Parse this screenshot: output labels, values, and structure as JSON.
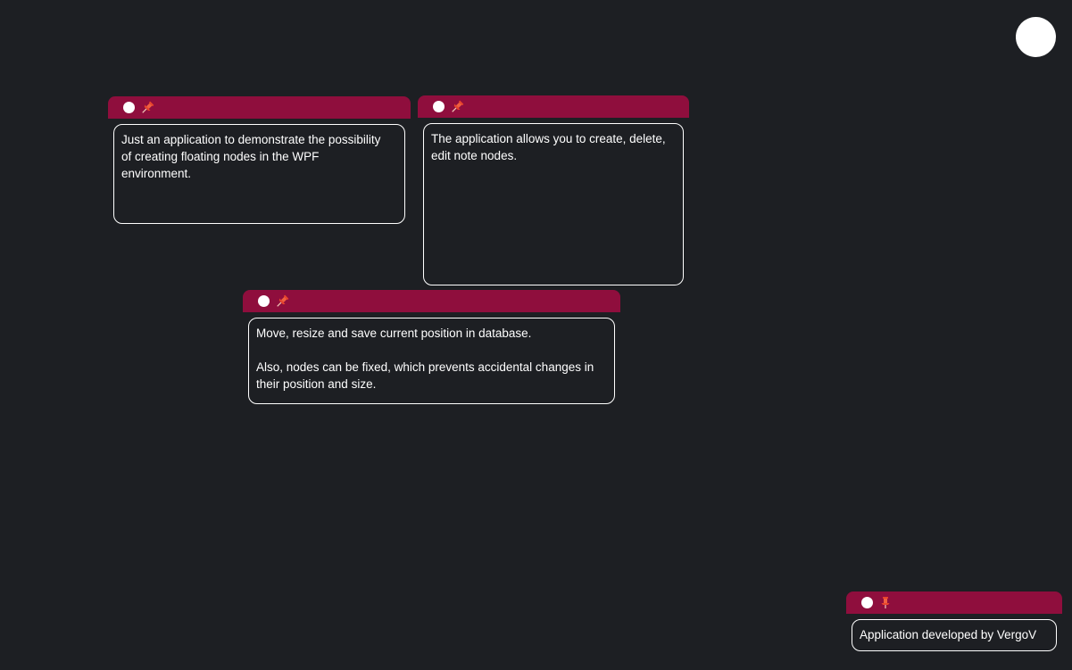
{
  "add_button": {
    "icon": "circle-icon",
    "color": "#ffffff"
  },
  "colors": {
    "background": "#1d1f23",
    "header": "#8f0e3d",
    "text": "#ffffff",
    "pin": "#e8452c"
  },
  "notes": [
    {
      "text": "Just an application to demonstrate the possibility\nof creating floating nodes in the WPF\nenvironment.",
      "pinned": false,
      "icons": [
        "circle-icon",
        "pin-icon"
      ]
    },
    {
      "text": "The application allows you to create, delete,\nedit note nodes.",
      "pinned": false,
      "icons": [
        "circle-icon",
        "pin-icon"
      ]
    },
    {
      "text": "Move, resize and save current position in database.\n\nAlso, nodes can be fixed, which prevents accidental changes in\ntheir position and size.",
      "pinned": false,
      "icons": [
        "circle-icon",
        "pin-icon"
      ]
    },
    {
      "text": "Application developed by VergoV",
      "pinned": true,
      "icons": [
        "circle-icon",
        "pinned-icon"
      ]
    }
  ]
}
